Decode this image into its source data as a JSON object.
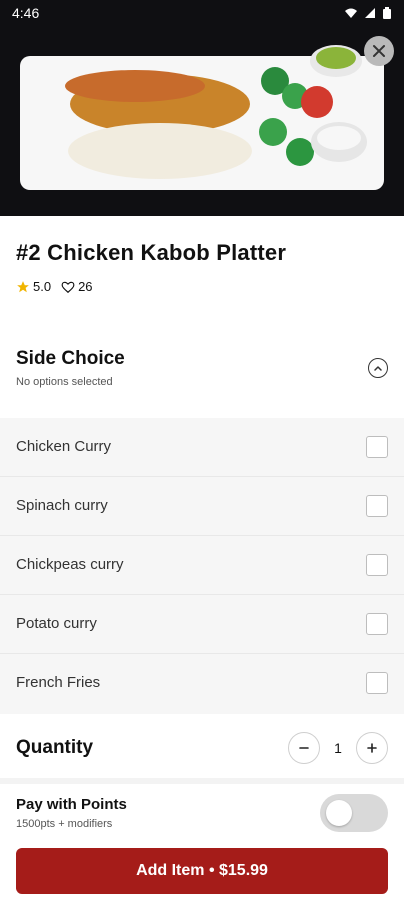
{
  "status_bar": {
    "time": "4:46"
  },
  "item": {
    "title": "#2 Chicken Kabob Platter",
    "rating": "5.0",
    "likes": "26"
  },
  "side_choice": {
    "title": "Side Choice",
    "subtitle": "No options selected",
    "options": [
      {
        "label": "Chicken Curry"
      },
      {
        "label": "Spinach curry"
      },
      {
        "label": "Chickpeas curry"
      },
      {
        "label": "Potato curry"
      },
      {
        "label": "French Fries"
      }
    ]
  },
  "quantity": {
    "title": "Quantity",
    "value": "1"
  },
  "points": {
    "title": "Pay with Points",
    "subtitle": "1500pts + modifiers",
    "enabled": false
  },
  "cta": {
    "label": "Add Item • $15.99"
  },
  "colors": {
    "accent": "#a51c19",
    "toggle_off": "#d9d9d9"
  }
}
